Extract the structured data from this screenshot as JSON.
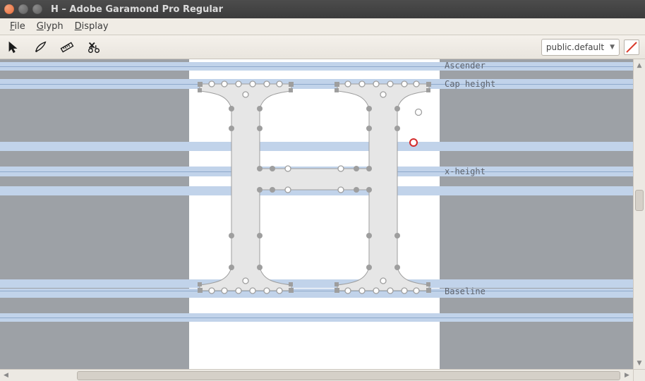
{
  "window": {
    "title": "H – Adobe Garamond Pro Regular"
  },
  "menu": {
    "file": "File",
    "glyph": "Glyph",
    "display": "Display"
  },
  "toolbar": {
    "layer_selector": "public.default"
  },
  "metrics": {
    "ascender": "Ascender",
    "cap_height": "Cap height",
    "x_height": "x-height",
    "baseline": "Baseline"
  }
}
